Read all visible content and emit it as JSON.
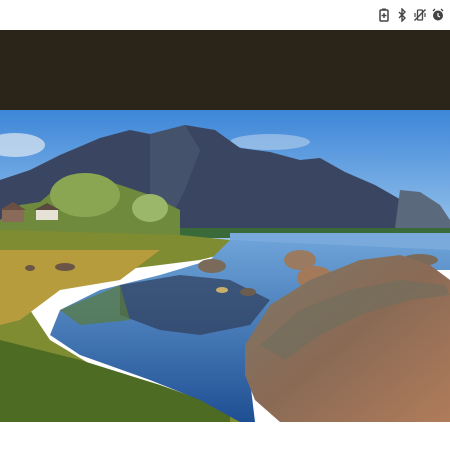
{
  "status_bar": {
    "icons": [
      "battery-saver-icon",
      "bluetooth-icon",
      "vibrate-mute-icon",
      "alarm-icon"
    ]
  },
  "photo": {
    "description_label": ""
  },
  "caption": {
    "text": ""
  },
  "colors": {
    "top_band": "#2a2419",
    "sky": "#4a8fd6",
    "water": "#2f64a8"
  }
}
